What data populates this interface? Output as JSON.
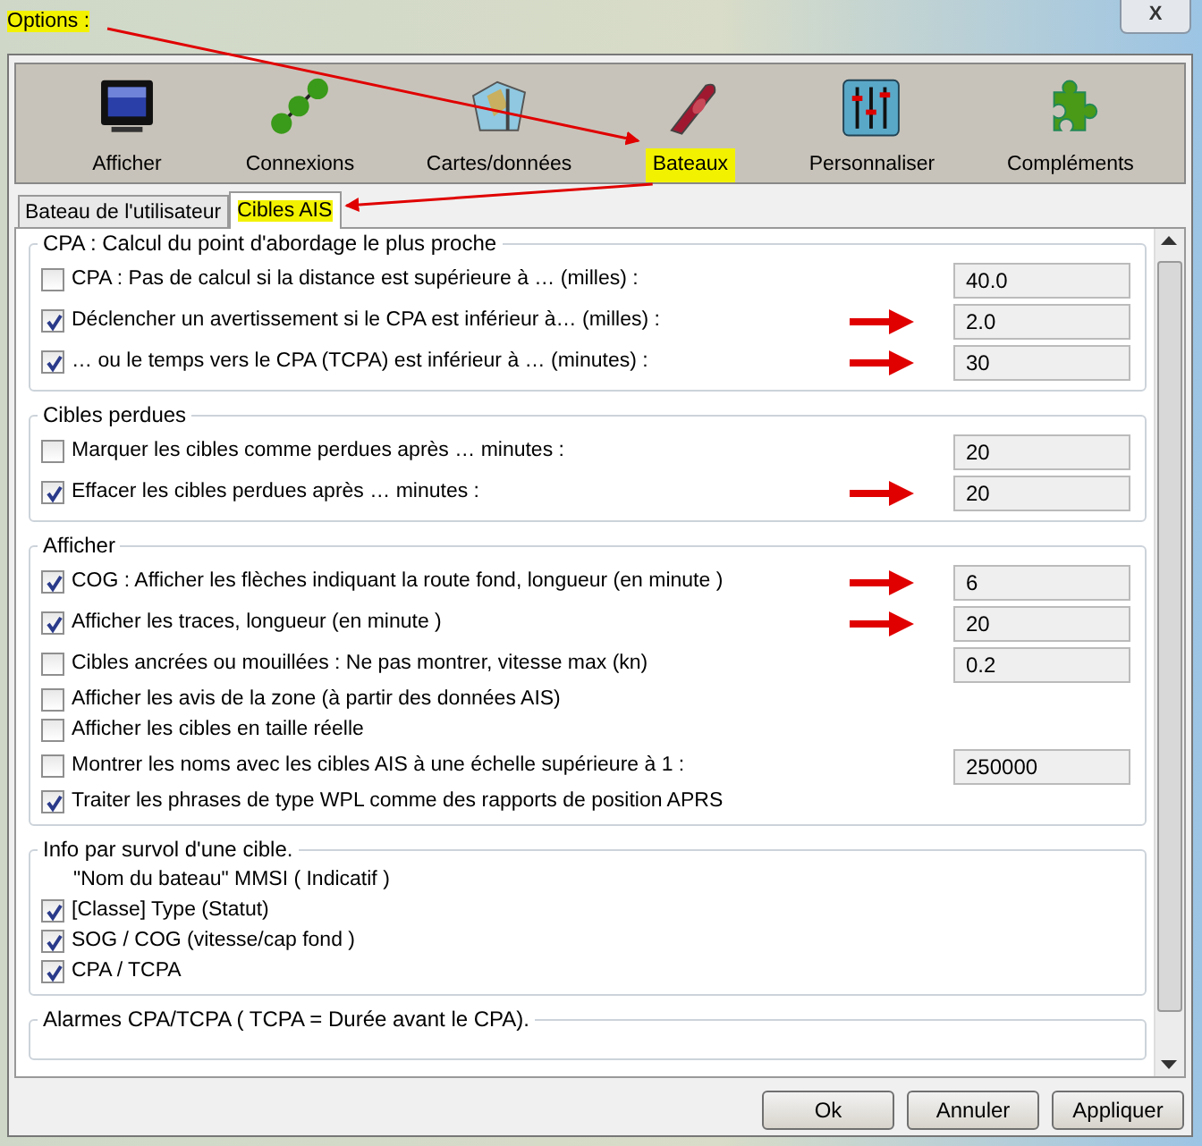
{
  "window": {
    "title": "Options :",
    "title_highlighted": true,
    "close": "X"
  },
  "toolbar": [
    {
      "label": "Afficher",
      "kind": "monitor",
      "selected": false
    },
    {
      "label": "Connexions",
      "kind": "nodes",
      "selected": false
    },
    {
      "label": "Cartes/données",
      "kind": "map",
      "selected": false
    },
    {
      "label": "Bateaux",
      "kind": "boat",
      "selected": true
    },
    {
      "label": "Personnaliser",
      "kind": "sliders",
      "selected": false
    },
    {
      "label": "Compléments",
      "kind": "puzzle",
      "selected": false
    }
  ],
  "tabs": [
    {
      "label": "Bateau de l'utilisateur",
      "selected": false
    },
    {
      "label": "Cibles AIS",
      "selected": true
    }
  ],
  "sections": [
    {
      "title": "CPA : Calcul du point d'abordage le plus proche",
      "rows": [
        {
          "kind": "checkbox",
          "label": "CPA : Pas de calcul si la distance est supérieure à … (milles) :",
          "checked": false,
          "value": "40.0",
          "marked": false
        },
        {
          "kind": "checkbox",
          "label": "Déclencher un avertissement si le CPA est inférieur à… (milles) :",
          "checked": true,
          "value": "2.0",
          "marked": true
        },
        {
          "kind": "checkbox",
          "label": " … ou le temps vers le CPA (TCPA) est inférieur à … (minutes) :",
          "checked": true,
          "value": "30",
          "marked": true
        }
      ]
    },
    {
      "title": "Cibles perdues",
      "rows": [
        {
          "kind": "checkbox",
          "label": "Marquer les cibles comme perdues après … minutes :",
          "checked": false,
          "value": "20",
          "marked": false
        },
        {
          "kind": "checkbox",
          "label": "Effacer les cibles perdues après … minutes :",
          "checked": true,
          "value": "20",
          "marked": true
        }
      ]
    },
    {
      "title": "Afficher",
      "rows": [
        {
          "kind": "checkbox",
          "label": "COG : Afficher les flèches indiquant la route fond, longueur (en minute )",
          "checked": true,
          "value": "6",
          "marked": true
        },
        {
          "kind": "checkbox",
          "label": "Afficher les traces, longueur (en minute )",
          "checked": true,
          "value": "20",
          "marked": true
        },
        {
          "kind": "checkbox",
          "label": "Cibles ancrées ou mouillées : Ne pas montrer, vitesse max (kn)",
          "checked": false,
          "value": "0.2",
          "marked": false
        },
        {
          "kind": "checkbox",
          "label": "Afficher les avis de la zone (à partir des données AIS)",
          "checked": false,
          "marked": false
        },
        {
          "kind": "checkbox",
          "label": "Afficher les cibles en taille réelle",
          "checked": false,
          "marked": false
        },
        {
          "kind": "checkbox",
          "label": "Montrer les noms avec les cibles AIS à une échelle supérieure à 1 :",
          "checked": false,
          "value": "250000",
          "marked": false
        },
        {
          "kind": "checkbox",
          "label": "Traiter les phrases de type WPL comme des rapports de position APRS",
          "checked": true,
          "marked": false
        }
      ]
    },
    {
      "title": "Info par survol d'une cible.",
      "rows": [
        {
          "kind": "text",
          "label": "\"Nom du bateau\"  MMSI  ( Indicatif )"
        },
        {
          "kind": "checkbox",
          "label": "[Classe] Type (Statut)",
          "checked": true,
          "marked": false
        },
        {
          "kind": "checkbox",
          "label": "SOG / COG  (vitesse/cap fond )",
          "checked": true,
          "marked": false
        },
        {
          "kind": "checkbox",
          "label": "CPA / TCPA",
          "checked": true,
          "marked": false
        }
      ]
    },
    {
      "title": "Alarmes CPA/TCPA ( TCPA = Durée avant le CPA)."
    }
  ],
  "buttons": [
    "Ok",
    "Annuler",
    "Appliquer"
  ]
}
